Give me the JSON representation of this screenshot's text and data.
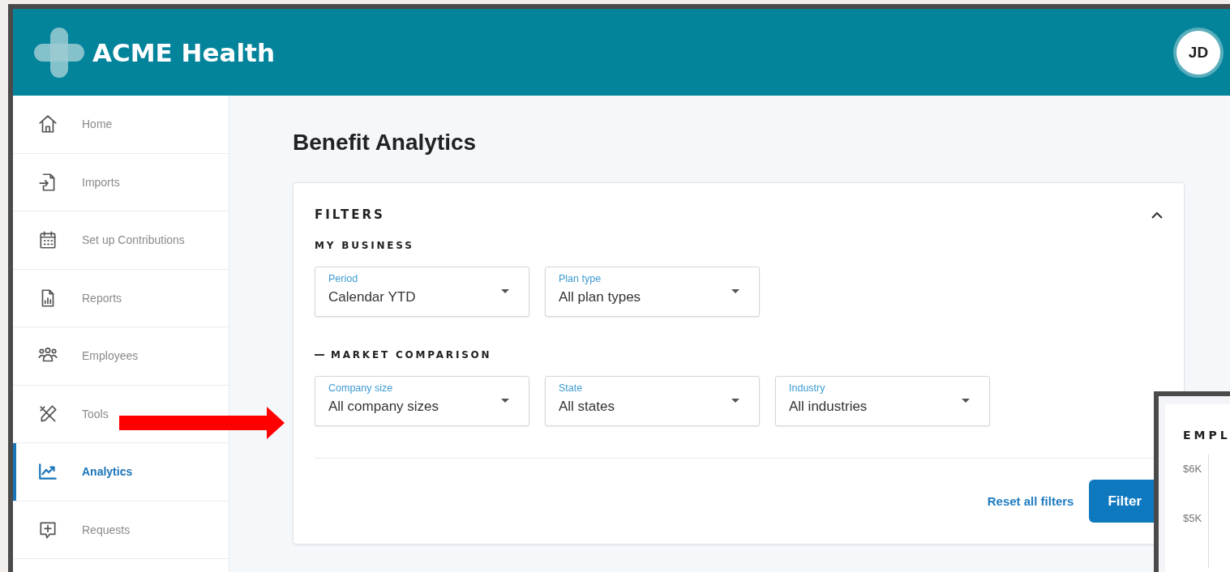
{
  "header": {
    "brand": "ACME Health",
    "avatar": "JD"
  },
  "sidebar": {
    "items": [
      {
        "label": "Home",
        "selected": false
      },
      {
        "label": "Imports",
        "selected": false
      },
      {
        "label": "Set up Contributions",
        "selected": false
      },
      {
        "label": "Reports",
        "selected": false
      },
      {
        "label": "Employees",
        "selected": false
      },
      {
        "label": "Tools",
        "selected": false
      },
      {
        "label": "Analytics",
        "selected": true
      },
      {
        "label": "Requests",
        "selected": false
      }
    ]
  },
  "page_title": "Benefit Analytics",
  "filters": {
    "title": "FILTERS",
    "expanded": true,
    "sections": [
      {
        "title": "MY BUSINESS",
        "fields": [
          {
            "label": "Period",
            "value": "Calendar YTD"
          },
          {
            "label": "Plan type",
            "value": "All plan types"
          }
        ]
      },
      {
        "title": "MARKET COMPARISON",
        "expanded": true,
        "fields": [
          {
            "label": "Company size",
            "value": "All company sizes"
          },
          {
            "label": "State",
            "value": "All states"
          },
          {
            "label": "Industry",
            "value": "All industries"
          }
        ]
      }
    ],
    "buttons": [
      {
        "label": "Reset all filters",
        "kind": "link"
      },
      {
        "label": "Filter",
        "kind": "primary"
      }
    ]
  },
  "overlay_window": {
    "title": "EMPL",
    "y_ticks": [
      "$6K",
      "$5K"
    ]
  },
  "annotations": [
    {
      "kind": "arrow",
      "color": "#ff0000"
    }
  ]
}
